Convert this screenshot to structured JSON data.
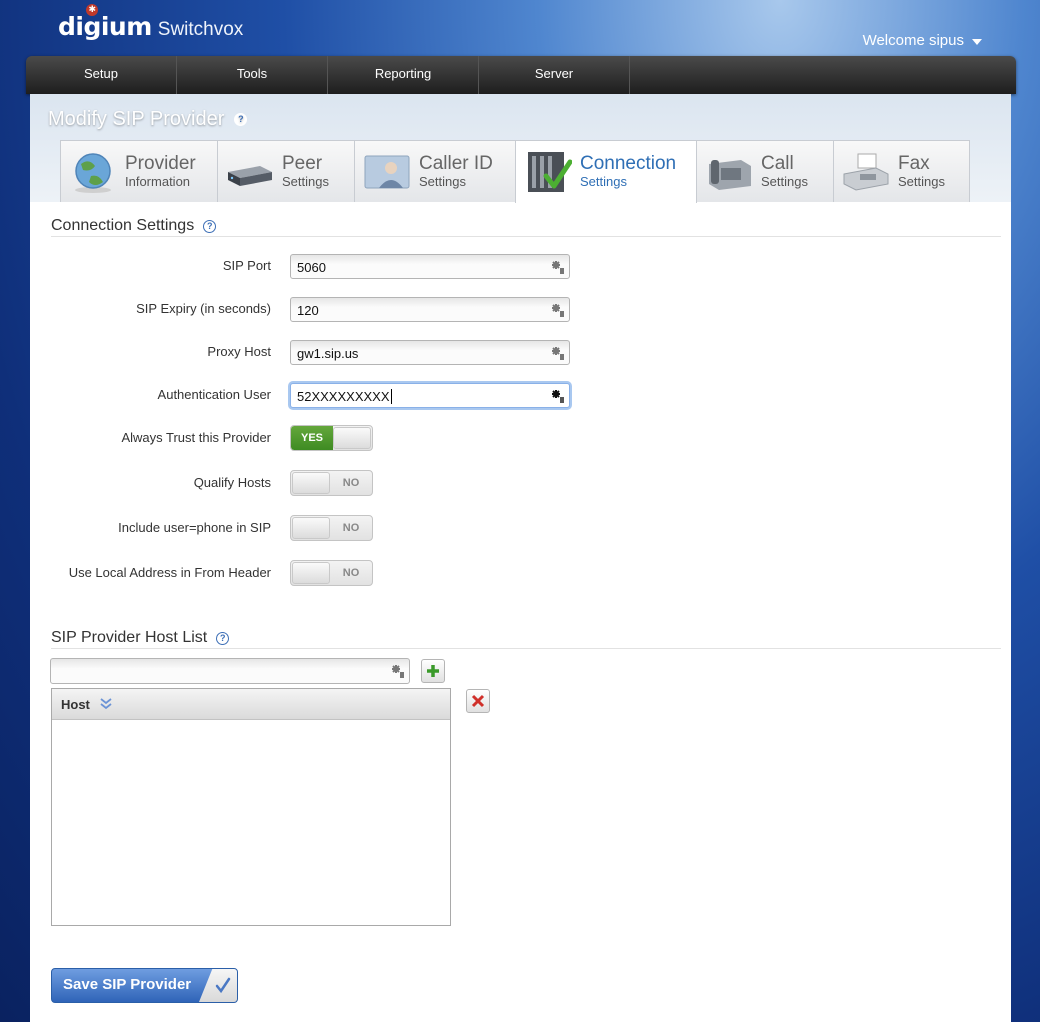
{
  "brand": {
    "logo": "digium",
    "product": "Switchvox"
  },
  "user": {
    "welcome": "Welcome sipus"
  },
  "nav": {
    "items": [
      "Setup",
      "Tools",
      "Reporting",
      "Server"
    ]
  },
  "page": {
    "title": "Modify SIP Provider"
  },
  "tabs": [
    {
      "title": "Provider",
      "subtitle": "Information",
      "icon": "globe-icon"
    },
    {
      "title": "Peer",
      "subtitle": "Settings",
      "icon": "router-icon"
    },
    {
      "title": "Caller ID",
      "subtitle": "Settings",
      "icon": "person-icon"
    },
    {
      "title": "Connection",
      "subtitle": "Settings",
      "icon": "connection-check-icon",
      "active": true
    },
    {
      "title": "Call",
      "subtitle": "Settings",
      "icon": "phone-icon"
    },
    {
      "title": "Fax",
      "subtitle": "Settings",
      "icon": "fax-icon"
    }
  ],
  "connection": {
    "title": "Connection Settings",
    "fields": [
      {
        "label": "SIP Port",
        "value": "5060"
      },
      {
        "label": "SIP Expiry (in seconds)",
        "value": "120"
      },
      {
        "label": "Proxy Host",
        "value": "gw1.sip.us"
      },
      {
        "label": "Authentication User",
        "value": "52XXXXXXXXX"
      }
    ],
    "toggles": [
      {
        "label": "Always Trust this Provider",
        "state": "YES"
      },
      {
        "label": "Qualify Hosts",
        "state": "NO"
      },
      {
        "label": "Include user=phone in SIP",
        "state": "NO"
      },
      {
        "label": "Use Local Address in From Header",
        "state": "NO"
      }
    ]
  },
  "host_list": {
    "title": "SIP Provider Host List",
    "input_value": "",
    "column": "Host",
    "rows": []
  },
  "save_label": "Save SIP Provider",
  "colors": {
    "accent": "#2f6fb5",
    "toggle_on": "#4a9a2c",
    "nav": "#2a2a2a"
  }
}
